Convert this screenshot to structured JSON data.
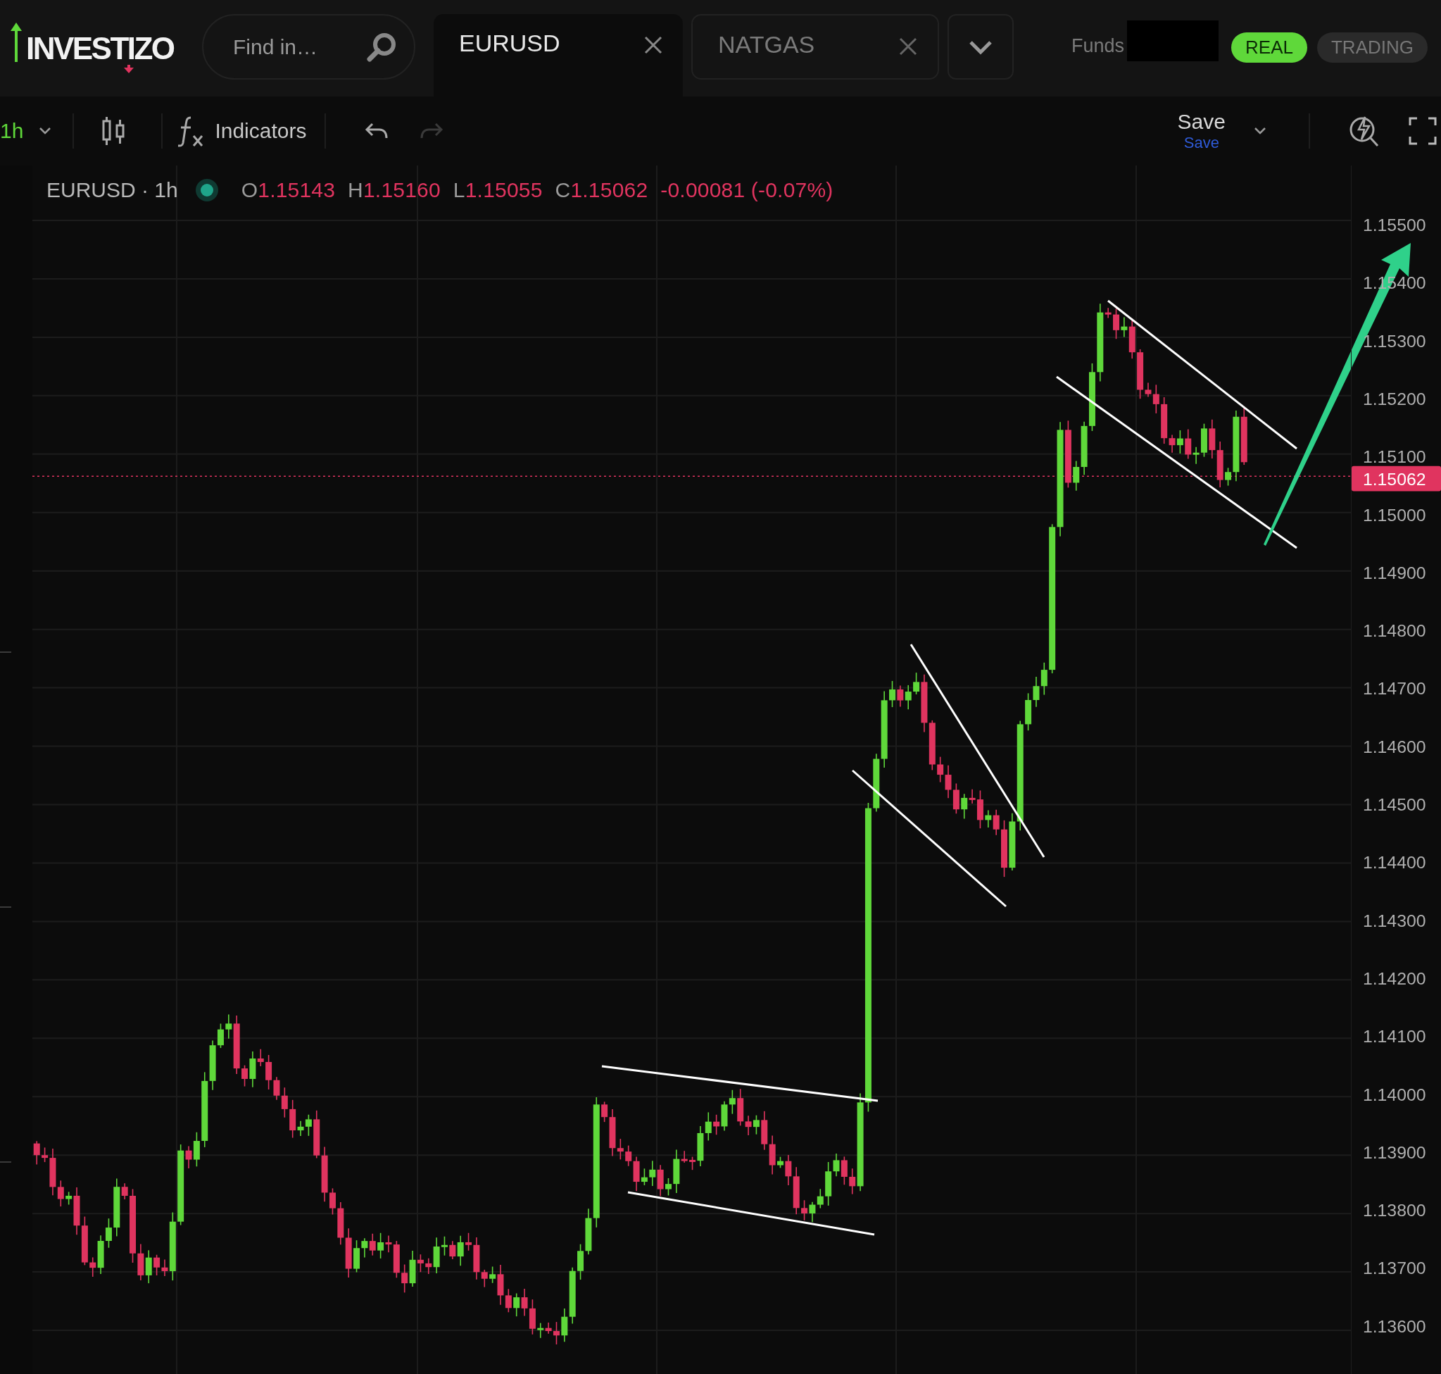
{
  "logo": {
    "text": "INVESTIZO"
  },
  "search": {
    "placeholder": "Find in…"
  },
  "tabs": [
    {
      "label": "EURUSD",
      "selected": true
    },
    {
      "label": "NATGAS",
      "selected": false
    }
  ],
  "funds": {
    "label": "Funds"
  },
  "account_modes": [
    {
      "label": "REAL",
      "selected": true
    },
    {
      "label": "TRADING",
      "selected": false
    }
  ],
  "toolbar": {
    "interval": "1h",
    "indicators": "Indicators",
    "redo_disabled": true,
    "save": "Save",
    "save_caption": "Save"
  },
  "legend": {
    "title": "EURUSD · 1h",
    "live": true,
    "ohlc": [
      {
        "label": "O",
        "value": "1.15143"
      },
      {
        "label": "H",
        "value": "1.15160"
      },
      {
        "label": "L",
        "value": "1.15055"
      },
      {
        "label": "C",
        "value": "1.15062"
      }
    ],
    "change": "-0.00081 (-0.07%)"
  },
  "price_axis": {
    "labels": [
      "1.15500",
      "1.15400",
      "1.15300",
      "1.15200",
      "1.15100",
      "1.15000",
      "1.14900",
      "1.14800",
      "1.14700",
      "1.14600",
      "1.14500",
      "1.14400",
      "1.14300",
      "1.14200",
      "1.14100",
      "1.14000",
      "1.13900",
      "1.13800",
      "1.13700",
      "1.13600"
    ],
    "current_price": "1.15062"
  }
}
